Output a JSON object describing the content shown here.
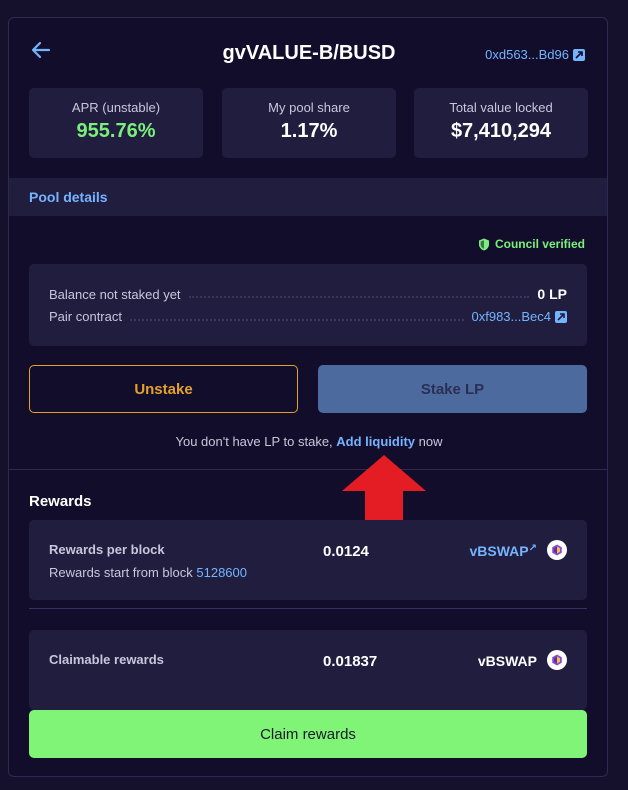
{
  "header": {
    "title": "gvVALUE-B/BUSD",
    "address": "0xd563...Bd96"
  },
  "stats": [
    {
      "label": "APR (unstable)",
      "value": "955.76%"
    },
    {
      "label": "My pool share",
      "value": "1.17%"
    },
    {
      "label": "Total value locked",
      "value": "$7,410,294"
    }
  ],
  "pool_details": {
    "heading": "Pool details",
    "verified_label": "Council verified",
    "rows": [
      {
        "label": "Balance not staked yet",
        "value": "0 LP"
      },
      {
        "label": "Pair contract",
        "value": "0xf983...Bec4"
      }
    ]
  },
  "actions": {
    "unstake_label": "Unstake",
    "stake_label": "Stake LP",
    "hint_prefix": "You don't have LP to stake,",
    "hint_link": "Add liquidity",
    "hint_suffix": "now"
  },
  "rewards": {
    "heading": "Rewards",
    "per_block": {
      "label": "Rewards per block",
      "sub_prefix": "Rewards start from block",
      "sub_block": "5128600",
      "value": "0.0124",
      "token": "vBSWAP"
    },
    "claimable": {
      "label": "Claimable rewards",
      "value": "0.01837",
      "token": "vBSWAP"
    },
    "claim_label": "Claim rewards"
  },
  "colors": {
    "background": "#110d2b",
    "card": "#211d3e",
    "accent_blue": "#74b4ff",
    "accent_green": "#7bef7b",
    "accent_orange": "#e5a12a",
    "arrow_red": "#e41c23"
  },
  "icons": {
    "back": "arrow-left-icon",
    "external": "external-link-icon",
    "shield": "shield-check-icon",
    "token": "vbswap-token-icon",
    "annotation": "red-up-arrow-icon"
  }
}
